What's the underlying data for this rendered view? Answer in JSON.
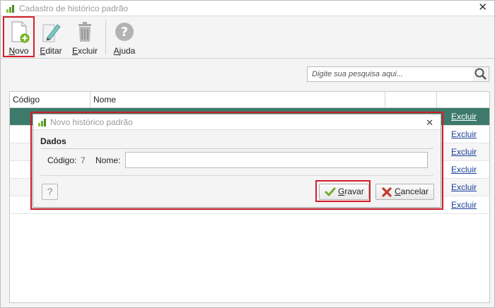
{
  "window": {
    "title": "Cadastro de histórico padrão",
    "close_glyph": "✕"
  },
  "toolbar": {
    "novo": {
      "label_first": "N",
      "label_rest": "ovo",
      "icon": "new-document-icon"
    },
    "editar": {
      "label_first": "E",
      "label_rest": "ditar",
      "icon": "pencil-icon"
    },
    "excluir": {
      "label_first": "E",
      "label_rest": "xcluir",
      "icon": "trash-icon"
    },
    "ajuda": {
      "label_first": "A",
      "label_rest": "juda",
      "icon": "help-icon"
    }
  },
  "search": {
    "placeholder": "Digite sua pesquisa aqui...",
    "icon": "search-icon"
  },
  "grid": {
    "columns": [
      "Código",
      "Nome",
      "",
      ""
    ],
    "rows": [
      {
        "action": "Excluir",
        "selected": true
      },
      {
        "action": "Excluir"
      },
      {
        "action": "Excluir"
      },
      {
        "action": "Excluir"
      },
      {
        "action": "Excluir"
      },
      {
        "action": "Excluir"
      }
    ]
  },
  "dialog": {
    "title": "Novo histórico padrão",
    "close_glyph": "✕",
    "section": "Dados",
    "codigo_label": "Código:",
    "codigo_value": "7",
    "nome_label": "Nome:",
    "nome_value": "",
    "help_glyph": "?",
    "gravar_first": "G",
    "gravar_rest": "ravar",
    "cancelar_first": "C",
    "cancelar_rest": "ancelar"
  },
  "colors": {
    "selected_row": "#3d7a6c",
    "highlight": "#d4202a",
    "link": "#1a3e9a",
    "check": "#6fae2a",
    "cancel_x": "#c0392b"
  }
}
